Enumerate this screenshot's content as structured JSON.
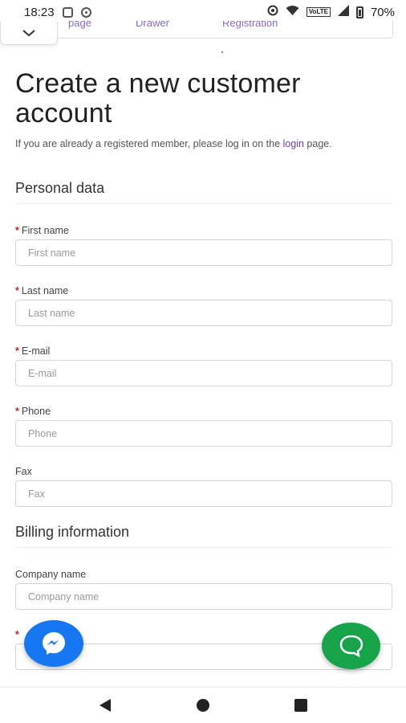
{
  "status_bar": {
    "time": "18:23",
    "network_label": "VoLTE",
    "battery": "70%",
    "icons": [
      "screen-record-icon",
      "instagram-icon",
      "location-icon",
      "wifi-icon",
      "signal-icon",
      "battery-icon"
    ]
  },
  "breadcrumb": {
    "items": [
      "page",
      "Drawer",
      "Registration"
    ]
  },
  "page": {
    "title": "Create a new customer account",
    "intro_prefix": "If you are already a registered member, please log in on the ",
    "intro_link": "login",
    "intro_suffix": " page."
  },
  "personal": {
    "heading": "Personal data",
    "first_name": {
      "label": "First name",
      "placeholder": "First name",
      "required": true
    },
    "last_name": {
      "label": "Last name",
      "placeholder": "Last name",
      "required": true
    },
    "email": {
      "label": "E-mail",
      "placeholder": "E-mail",
      "required": true
    },
    "phone": {
      "label": "Phone",
      "placeholder": "Phone",
      "required": true
    },
    "fax": {
      "label": "Fax",
      "placeholder": "Fax",
      "required": false
    }
  },
  "billing": {
    "heading": "Billing information",
    "company": {
      "label": "Company name",
      "placeholder": "Company name",
      "required": false
    },
    "next_field_required_mark": "*"
  },
  "colors": {
    "link": "#6a3fb0",
    "required": "#cc2222",
    "messenger": "#1677f2",
    "chat": "#16a34a"
  },
  "nav": [
    "back-icon",
    "home-icon",
    "recents-icon"
  ]
}
